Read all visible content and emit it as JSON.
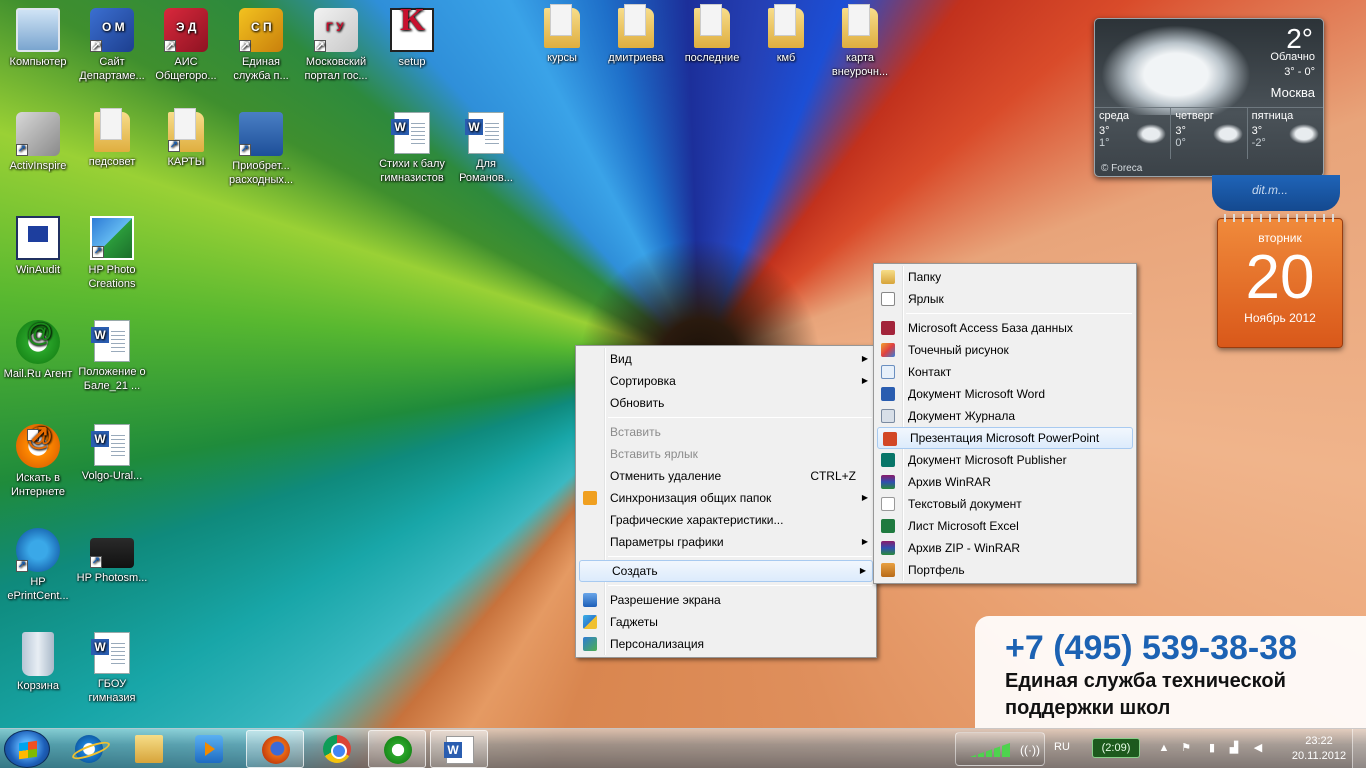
{
  "desktop": {
    "icons": [
      {
        "label": "Компьютер"
      },
      {
        "label": "Сайт Департаме...",
        "glyph": "О М"
      },
      {
        "label": "АИС Общегоро...",
        "glyph": "Э Д"
      },
      {
        "label": "Единая служба п...",
        "glyph": "С П"
      },
      {
        "label": "Московский портал гос...",
        "glyph": "Г У"
      },
      {
        "label": "setup",
        "glyph": "K"
      },
      {
        "label": "курсы"
      },
      {
        "label": "дмитриева"
      },
      {
        "label": "последние"
      },
      {
        "label": "кмб"
      },
      {
        "label": "карта внеурочн..."
      },
      {
        "label": "ActivInspire"
      },
      {
        "label": "педсовет"
      },
      {
        "label": "КАРТЫ"
      },
      {
        "label": "Приобрет... расходных..."
      },
      {
        "label": "Стихи к балу гимназистов",
        "glyph": "W"
      },
      {
        "label": "Для Романов...",
        "glyph": "W"
      },
      {
        "label": "WinAudit"
      },
      {
        "label": "HP Photo Creations"
      },
      {
        "label": "Mail.Ru Агент",
        "glyph": "@"
      },
      {
        "label": "Положение о Бале_21 ...",
        "glyph": "W"
      },
      {
        "label": "Искать в Интернете",
        "glyph": "@"
      },
      {
        "label": "Volgo-Ural...",
        "glyph": "W"
      },
      {
        "label": "HP ePrintCent..."
      },
      {
        "label": "HP Photosm..."
      },
      {
        "label": "Корзина"
      },
      {
        "label": "ГБОУ гимназия",
        "glyph": "W"
      }
    ]
  },
  "weather": {
    "temp": "2°",
    "condition": "Облачно",
    "range": "3° - 0°",
    "city": "Москва",
    "days": [
      {
        "name": "среда",
        "hi": "3°",
        "lo": "1°"
      },
      {
        "name": "четверг",
        "hi": "3°",
        "lo": "0°"
      },
      {
        "name": "пятница",
        "hi": "3°",
        "lo": "-2°"
      }
    ],
    "source": "© Foreca",
    "ribbon": "dit.m..."
  },
  "calendar": {
    "weekday": "вторник",
    "day": "20",
    "month_year": "Ноябрь 2012"
  },
  "context_menu": {
    "items": [
      {
        "label": "Вид"
      },
      {
        "label": "Сортировка"
      },
      {
        "label": "Обновить"
      },
      {
        "label": "Вставить"
      },
      {
        "label": "Вставить ярлык"
      },
      {
        "label": "Отменить удаление",
        "accel": "CTRL+Z"
      },
      {
        "label": "Синхронизация общих папок"
      },
      {
        "label": "Графические характеристики..."
      },
      {
        "label": "Параметры графики"
      },
      {
        "label": "Создать"
      },
      {
        "label": "Разрешение экрана"
      },
      {
        "label": "Гаджеты"
      },
      {
        "label": "Персонализация"
      }
    ]
  },
  "create_submenu": {
    "items": [
      {
        "label": "Папку"
      },
      {
        "label": "Ярлык"
      },
      {
        "label": "Microsoft Access База данных"
      },
      {
        "label": "Точечный рисунок"
      },
      {
        "label": "Контакт"
      },
      {
        "label": "Документ Microsoft Word"
      },
      {
        "label": "Документ Журнала"
      },
      {
        "label": "Презентация Microsoft PowerPoint"
      },
      {
        "label": "Документ Microsoft Publisher"
      },
      {
        "label": "Архив WinRAR"
      },
      {
        "label": "Текстовый документ"
      },
      {
        "label": "Лист Microsoft Excel"
      },
      {
        "label": "Архив ZIP - WinRAR"
      },
      {
        "label": "Портфель"
      }
    ]
  },
  "info_box": {
    "phone": "+7 (495) 539-38-38",
    "title": "Единая служба технической поддержки школ"
  },
  "taskbar": {
    "pinned": [
      "internet-explorer",
      "explorer",
      "media-player",
      "firefox",
      "chrome",
      "mail-ru-agent",
      "word"
    ],
    "language": "RU",
    "battery": "(2:09)",
    "time": "23:22",
    "date": "20.11.2012"
  }
}
